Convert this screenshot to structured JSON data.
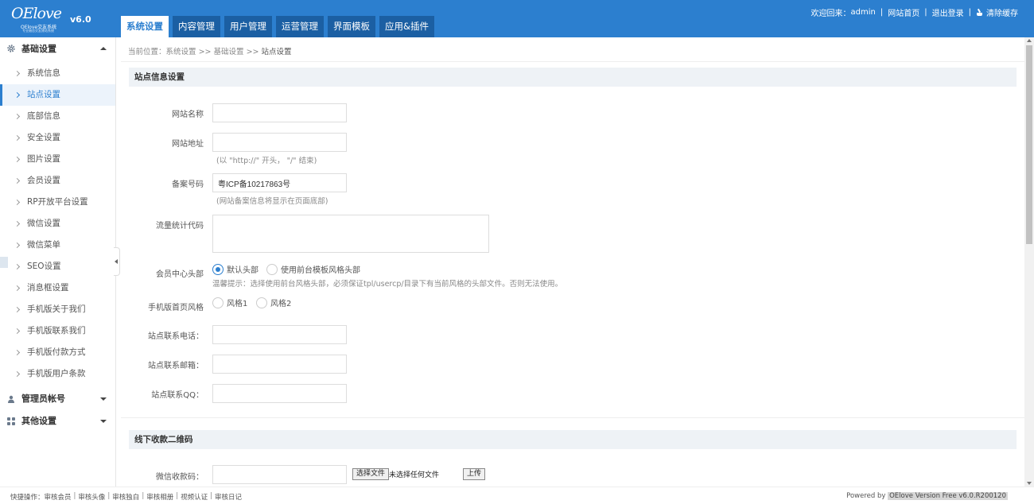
{
  "header": {
    "logo_text": "OElove",
    "logo_tagline": "OElove交友系统",
    "logo_subtagline": "专业婚恋交友建站系统",
    "version": "v6.0",
    "tabs": [
      {
        "label": "系统设置",
        "active": true
      },
      {
        "label": "内容管理"
      },
      {
        "label": "用户管理"
      },
      {
        "label": "运营管理"
      },
      {
        "label": "界面模板"
      },
      {
        "label": "应用&插件"
      }
    ],
    "welcome_prefix": "欢迎回来：",
    "username": "admin",
    "sep": "|",
    "site_home": "网站首页",
    "logout": "退出登录",
    "clear_cache": "清除缓存"
  },
  "sidebar": {
    "groups": [
      {
        "label": "基础设置",
        "icon": "gear-icon",
        "expanded": true
      },
      {
        "label": "管理员帐号",
        "icon": "user-icon",
        "expanded": false
      },
      {
        "label": "其他设置",
        "icon": "grid-icon",
        "expanded": false
      }
    ],
    "items": [
      {
        "label": "系统信息"
      },
      {
        "label": "站点设置",
        "active": true
      },
      {
        "label": "底部信息"
      },
      {
        "label": "安全设置"
      },
      {
        "label": "图片设置"
      },
      {
        "label": "会员设置"
      },
      {
        "label": "RP开放平台设置"
      },
      {
        "label": "微信设置"
      },
      {
        "label": "微信菜单"
      },
      {
        "label": "SEO设置"
      },
      {
        "label": "消息框设置"
      },
      {
        "label": "手机版关于我们"
      },
      {
        "label": "手机版联系我们"
      },
      {
        "label": "手机版付款方式"
      },
      {
        "label": "手机版用户条款"
      }
    ]
  },
  "breadcrumb": {
    "prefix": "当前位置：",
    "l1": "系统设置",
    "arrow": ">>",
    "l2": "基础设置",
    "l3": "站点设置"
  },
  "form": {
    "section1_title": "站点信息设置",
    "site_name_label": "网站名称",
    "site_name_value": "",
    "site_url_label": "网站地址",
    "site_url_value": "",
    "site_url_hint": "(以 \"http://\" 开头，  \"/\" 结束)",
    "icp_label": "备案号码",
    "icp_value": "粤ICP备10217863号",
    "icp_hint": "(网站备案信息将显示在页面底部)",
    "stats_label": "流量统计代码",
    "stats_value": "",
    "member_header_label": "会员中心头部",
    "member_header_opt1": "默认头部",
    "member_header_opt2": "使用前台模板风格头部",
    "member_header_hint": "温馨提示：选择使用前台风格头部，必须保证tpl/usercp/目录下有当前风格的头部文件。否则无法使用。",
    "mobile_style_label": "手机版首页风格",
    "mobile_style_opt1": "风格1",
    "mobile_style_opt2": "风格2",
    "phone_label": "站点联系电话：",
    "phone_value": "",
    "email_label": "站点联系邮箱：",
    "email_value": "",
    "qq_label": "站点联系QQ：",
    "qq_value": "",
    "section2_title": "线下收款二维码",
    "wechat_qr_label": "微信收款码：",
    "wechat_qr_value": "",
    "choose_file": "选择文件",
    "no_file": "未选择任何文件",
    "upload": "上传"
  },
  "footer": {
    "quick_label": "快捷操作：",
    "links": [
      "审核会员",
      "审核头像",
      "审核独白",
      "审核相册",
      "视频认证",
      "审核日记"
    ],
    "powered_prefix": "Powered by",
    "version_text": "OElove Version Free v6.0.R200120"
  },
  "colors": {
    "primary": "#2c7fcf",
    "tab_dark": "#1b5fa3"
  }
}
